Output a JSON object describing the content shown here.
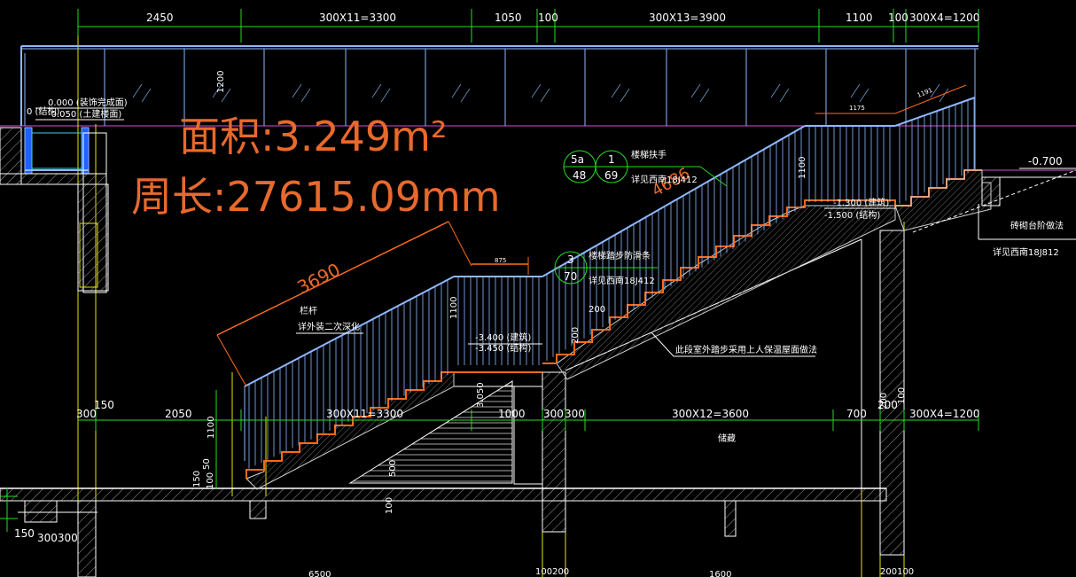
{
  "colors": {
    "background": "#000000",
    "dimension": "#22e022",
    "structure": "#ffffff",
    "railing": "#8fb8ff",
    "stair_finish": "#ff6a1a",
    "overlay_text": "#e8692c",
    "grid_yellow": "#e6e600",
    "magenta": "#d24fd2",
    "cyan": "#39d3e6"
  },
  "top_dimensions": [
    "2450",
    "300X11=3300",
    "1050",
    "100",
    "300X13=3900",
    "1100",
    "100",
    "300X4=1200"
  ],
  "bottom_dimensions": [
    "300",
    "150",
    "2050",
    "300X11=3300",
    "1000",
    "300",
    "300",
    "300X12=3600",
    "700",
    "200",
    "300X4=1200"
  ],
  "overlay": {
    "area": "面积:3.249m²",
    "perimeter": "周长:27615.09mm"
  },
  "measurements": {
    "diag_long": "3690",
    "diag_short": "875",
    "diag_upper": "4686",
    "top_right_short": "1175",
    "top_right_diag": "1191"
  },
  "vertical_dims": {
    "rail_height_top": "1200",
    "rail_height_mid": "1100",
    "rail_height_low": "1100",
    "rail_height_right": "1100",
    "step_200a": "200",
    "step_200b": "200",
    "left_1100": "1100",
    "left_150": "150",
    "left_100": "100",
    "left_50": "50",
    "mid_500": "500",
    "mid_100": "100",
    "mid_3050": "3.050",
    "right_100": "100",
    "right_200": "200",
    "bottom_150": "150",
    "bottom_300300": "300300",
    "bottom_100200": "100200",
    "bottom_200100": "200100",
    "bottom_6500": "6500",
    "bottom_1600": "1600"
  },
  "elevations": {
    "finish_0": "0.000 (装饰完成面)",
    "structure_0": "-0.050 (土建楼面)",
    "left_0": "0 (结构)",
    "minus_1300": "-1.300 (建筑)",
    "minus_1500": "-1.500 (结构)",
    "minus_3400": "-3.400 (建筑)",
    "minus_3450": "-3.450 (结构)",
    "minus_0700": "-0.700"
  },
  "callouts": {
    "handrail_title": "楼梯扶手",
    "handrail_ref": "详见西南18J412",
    "bubble_5a": "5a",
    "bubble_48": "48",
    "bubble_1": "1",
    "bubble_69": "69",
    "antislip_title": "楼梯踏步防滑条",
    "antislip_ref": "详见西南18J412",
    "bubble_3": "3",
    "bubble_70": "70",
    "railing_title": "栏杆",
    "railing_note": "详外装二次深化",
    "outdoor_step_note": "此段室外踏步采用上人保温屋面做法",
    "brick_title": "砖砌台阶做法",
    "brick_ref": "详见西南18J812",
    "room_label": "储藏"
  }
}
